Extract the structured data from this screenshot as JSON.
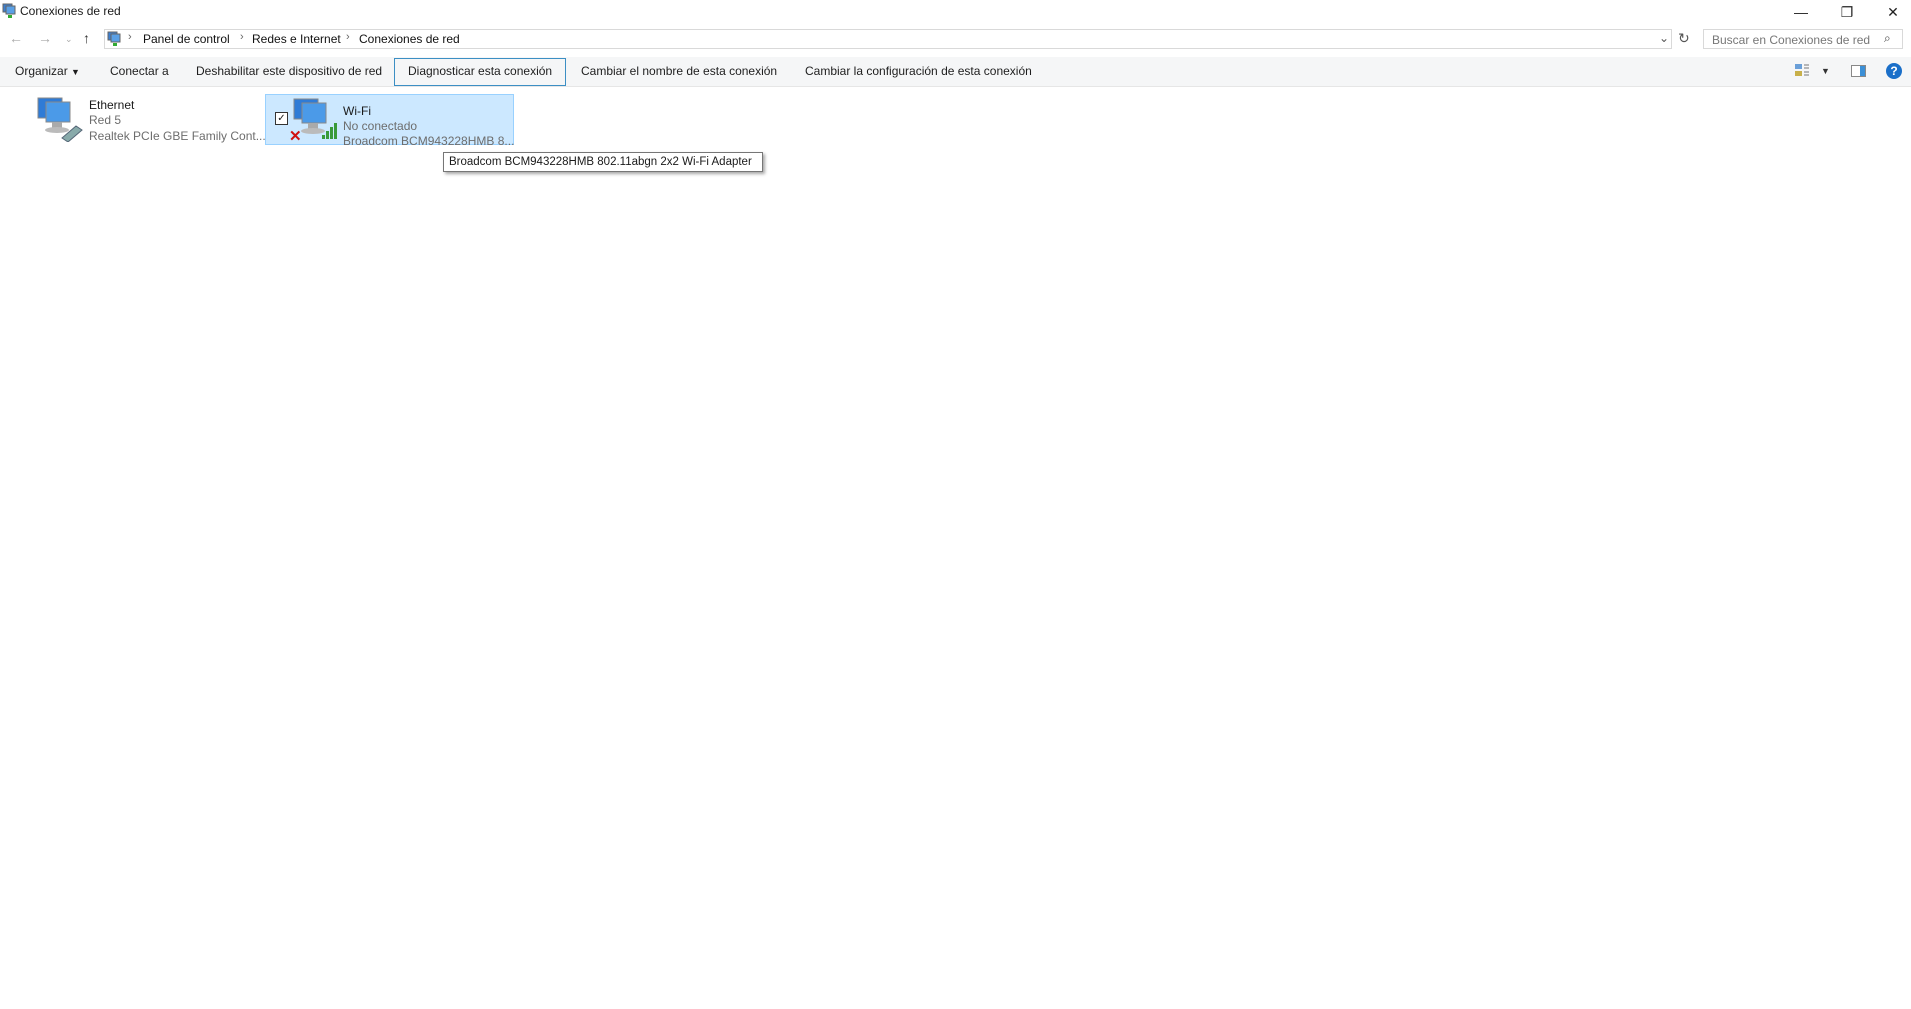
{
  "window": {
    "title": "Conexiones de red",
    "controls": [
      "minimize",
      "restore",
      "close"
    ]
  },
  "address": {
    "breadcrumbs": [
      "Panel de control",
      "Redes e Internet",
      "Conexiones de red"
    ],
    "search_placeholder": "Buscar en Conexiones de red"
  },
  "toolbar": {
    "organize": "Organizar",
    "connect": "Conectar a",
    "disable": "Deshabilitar este dispositivo de red",
    "diagnose": "Diagnosticar esta conexión",
    "rename": "Cambiar el nombre de esta conexión",
    "settings": "Cambiar la configuración de esta conexión"
  },
  "connections": [
    {
      "name": "Ethernet",
      "status": "Red 5",
      "adapter": "Realtek PCIe GBE Family Cont..."
    },
    {
      "name": "Wi-Fi",
      "status": "No conectado",
      "adapter": "Broadcom BCM943228HMB 8...",
      "selected": true
    }
  ],
  "tooltip": "Broadcom BCM943228HMB 802.11abgn 2x2 Wi-Fi Adapter",
  "colors": {
    "selection": "#cce8ff",
    "accent": "#3c8fc4",
    "help": "#1a6fc9"
  }
}
